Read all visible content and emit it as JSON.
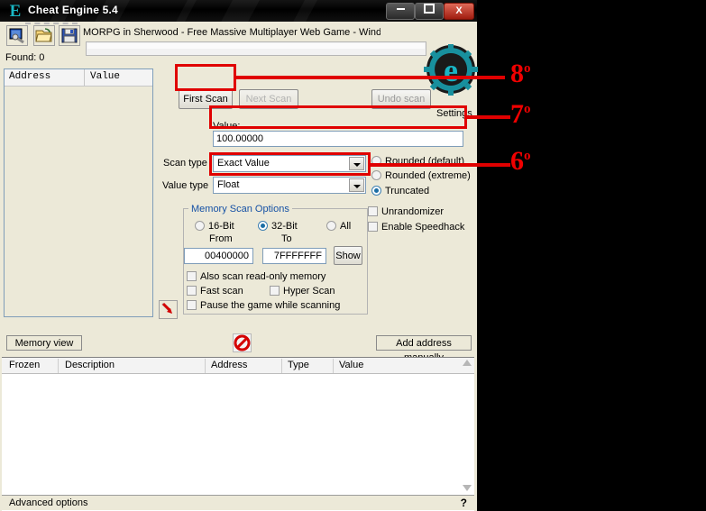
{
  "window": {
    "title": "Cheat Engine 5.4",
    "logo_glyph": "E",
    "buttons": {
      "minimize": "minimize-button",
      "maximize": "maximize-button",
      "close": "X"
    }
  },
  "toolbar": {
    "process_icon": "open-process-icon",
    "open_icon": "open-file-icon",
    "save_icon": "save-file-icon"
  },
  "background_window": {
    "title": "MORPG in Sherwood - Free Massive Multiplayer Web Game - Windows Internet Explo"
  },
  "status": {
    "found_label": "Found: 0"
  },
  "logo": {
    "settings_label": "Settings"
  },
  "results": {
    "columns": [
      "Address",
      "Value"
    ],
    "rows": []
  },
  "scan": {
    "first_scan": "First Scan",
    "next_scan": "Next Scan",
    "undo_scan": "Undo scan",
    "value_label": "Value:",
    "value": "100.00000",
    "scan_type_label": "Scan type",
    "scan_type": "Exact Value",
    "value_type_label": "Value type",
    "value_type": "Float",
    "rounding": [
      {
        "label": "Rounded (default)",
        "selected": false
      },
      {
        "label": "Rounded (extreme)",
        "selected": false
      },
      {
        "label": "Truncated",
        "selected": true
      }
    ],
    "checks_right": [
      {
        "label": "Unrandomizer",
        "checked": false
      },
      {
        "label": "Enable Speedhack",
        "checked": false
      }
    ]
  },
  "memory_scan_options": {
    "title": "Memory Scan Options",
    "bits": [
      {
        "label": "16-Bit",
        "selected": false
      },
      {
        "label": "32-Bit",
        "selected": true
      },
      {
        "label": "All",
        "selected": false
      }
    ],
    "from_label": "From",
    "to_label": "To",
    "from_value": "00400000",
    "to_value": "7FFFFFFF",
    "show_button": "Show",
    "checks": [
      {
        "label": "Also scan read-only memory",
        "checked": false
      },
      {
        "label": "Fast scan",
        "checked": false
      },
      {
        "label": "Hyper Scan",
        "checked": false
      },
      {
        "label": "Pause the game while scanning",
        "checked": false
      }
    ],
    "arrow_button_icon": "red-arrow-icon"
  },
  "bottom_toolbar": {
    "memory_view": "Memory view",
    "add_address_manually": "Add address manually",
    "stop_icon": "stop-forbidden-icon"
  },
  "cheat_table": {
    "columns": [
      "Frozen",
      "Description",
      "Address",
      "Type",
      "Value"
    ],
    "rows": []
  },
  "status_bar": {
    "advanced_options": "Advanced options",
    "help": "?"
  },
  "annotations": [
    {
      "id": "a8",
      "text": "8",
      "sup": "o"
    },
    {
      "id": "a7",
      "text": "7",
      "sup": "o"
    },
    {
      "id": "a6",
      "text": "6",
      "sup": "o"
    }
  ],
  "colors": {
    "annotation_red": "#e00000",
    "accent_teal": "#19b7c4",
    "group_title_blue": "#1551a5",
    "window_face": "#ece9d8"
  }
}
